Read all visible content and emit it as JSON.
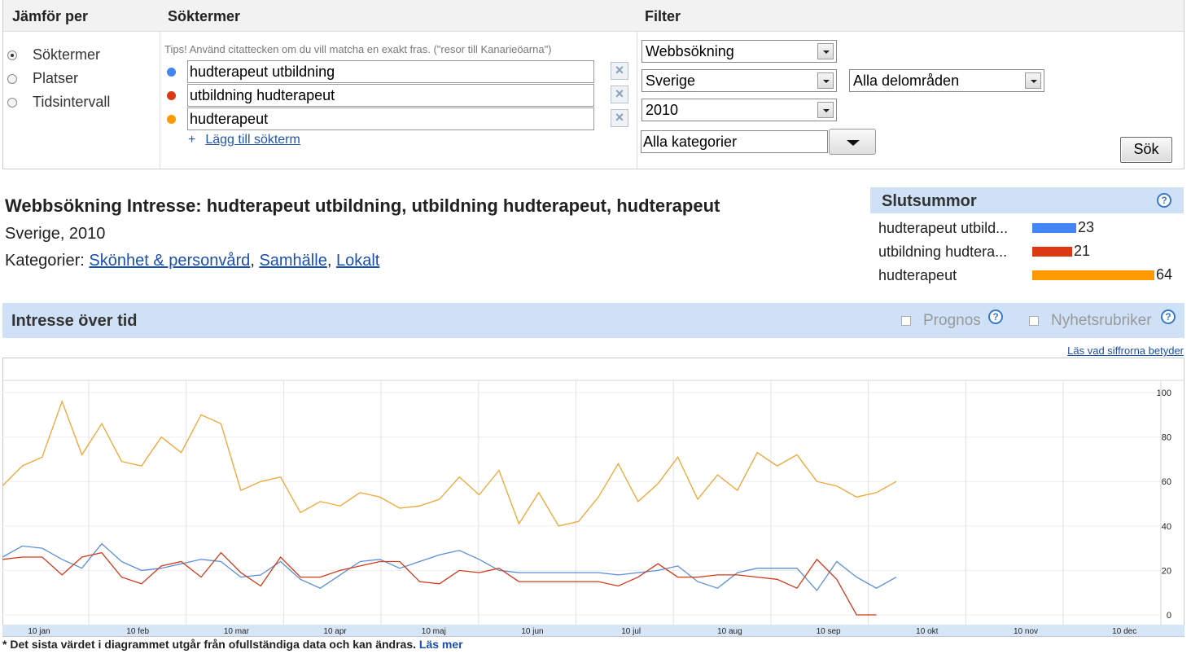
{
  "compare_panel": {
    "header": "Jämför per",
    "options": [
      {
        "label": "Söktermer",
        "checked": true
      },
      {
        "label": "Platser",
        "checked": false
      },
      {
        "label": "Tidsintervall",
        "checked": false
      }
    ]
  },
  "terms_panel": {
    "header": "Söktermer",
    "tips": "Tips! Använd citattecken om du vill matcha en exakt fras. (\"resor till Kanarieöarna\")",
    "terms": [
      {
        "value": "hudterapeut utbildning",
        "color": "#4285f4"
      },
      {
        "value": "utbildning hudterapeut",
        "color": "#dc3912"
      },
      {
        "value": "hudterapeut",
        "color": "#ff9900"
      }
    ],
    "remove_icon": "close-icon",
    "add_term_prefix": "+",
    "add_term": "Lägg till sökterm"
  },
  "filter_panel": {
    "header": "Filter",
    "search_type": "Webbsökning",
    "country": "Sverige",
    "subregion": "Alla delområden",
    "time": "2010",
    "category": "Alla kategorier",
    "search_button": "Sök"
  },
  "summary": {
    "title": "Webbsökning Intresse: hudterapeut utbildning, utbildning hudterapeut, hudterapeut",
    "subtitle": "Sverige, 2010",
    "categories_label": "Kategorier:",
    "categories": [
      "Skönhet & personvård",
      "Samhälle",
      "Lokalt"
    ]
  },
  "totals": {
    "header": "Slutsummor",
    "help_icon": "?",
    "items": [
      {
        "name": "hudterapeut utbild...",
        "value": 23,
        "color": "#4285f4"
      },
      {
        "name": "utbildning hudtera...",
        "value": 21,
        "color": "#dc3912"
      },
      {
        "name": "hudterapeut",
        "value": 64,
        "color": "#ff9900"
      }
    ]
  },
  "interest_over_time": {
    "header": "Intresse över tid",
    "forecast_label": "Prognos",
    "news_label": "Nyhetsrubriker",
    "help_icon": "?",
    "read_link": "Läs vad siffrorna betyder",
    "footnote_text": "* Det sista värdet i diagrammet utgår från ofullständiga data och kan ändras.",
    "footnote_link": "Läs mer"
  },
  "chart_data": {
    "type": "line",
    "x_labels": [
      "10 jan",
      "10 feb",
      "10 mar",
      "10 apr",
      "10 maj",
      "10 jun",
      "10 jul",
      "10 aug",
      "10 sep",
      "10 okt",
      "10 nov",
      "10 dec"
    ],
    "y_ticks": [
      0,
      20,
      40,
      60,
      80,
      100
    ],
    "ylim": [
      0,
      100
    ],
    "series": [
      {
        "name": "hudterapeut",
        "color": "#f2a431",
        "values": [
          58,
          67,
          71,
          96,
          72,
          86,
          69,
          67,
          80,
          73,
          90,
          86,
          56,
          60,
          62,
          46,
          51,
          49,
          55,
          53,
          48,
          49,
          52,
          62,
          54,
          65,
          41,
          55,
          40,
          42,
          53,
          68,
          51,
          59,
          71,
          52,
          63,
          56,
          73,
          67,
          72,
          60,
          58,
          53,
          55,
          60
        ]
      },
      {
        "name": "hudterapeut utbildning",
        "color": "#5b8ed6",
        "values": [
          26,
          31,
          30,
          25,
          21,
          32,
          24,
          20,
          21,
          23,
          25,
          24,
          17,
          18,
          24,
          16,
          12,
          18,
          24,
          25,
          21,
          24,
          27,
          29,
          25,
          20,
          19,
          19,
          19,
          19,
          19,
          18,
          19,
          20,
          22,
          15,
          12,
          19,
          21,
          21,
          21,
          11,
          24,
          17,
          12,
          17
        ]
      },
      {
        "name": "utbildning hudterapeut",
        "color": "#d23a1a",
        "values": [
          25,
          26,
          26,
          18,
          26,
          28,
          17,
          14,
          22,
          24,
          17,
          28,
          19,
          13,
          26,
          17,
          17,
          20,
          22,
          24,
          24,
          15,
          14,
          20,
          19,
          21,
          15,
          15,
          15,
          15,
          15,
          13,
          17,
          23,
          17,
          17,
          18,
          18,
          17,
          16,
          12,
          25,
          16,
          0,
          0
        ]
      }
    ]
  }
}
